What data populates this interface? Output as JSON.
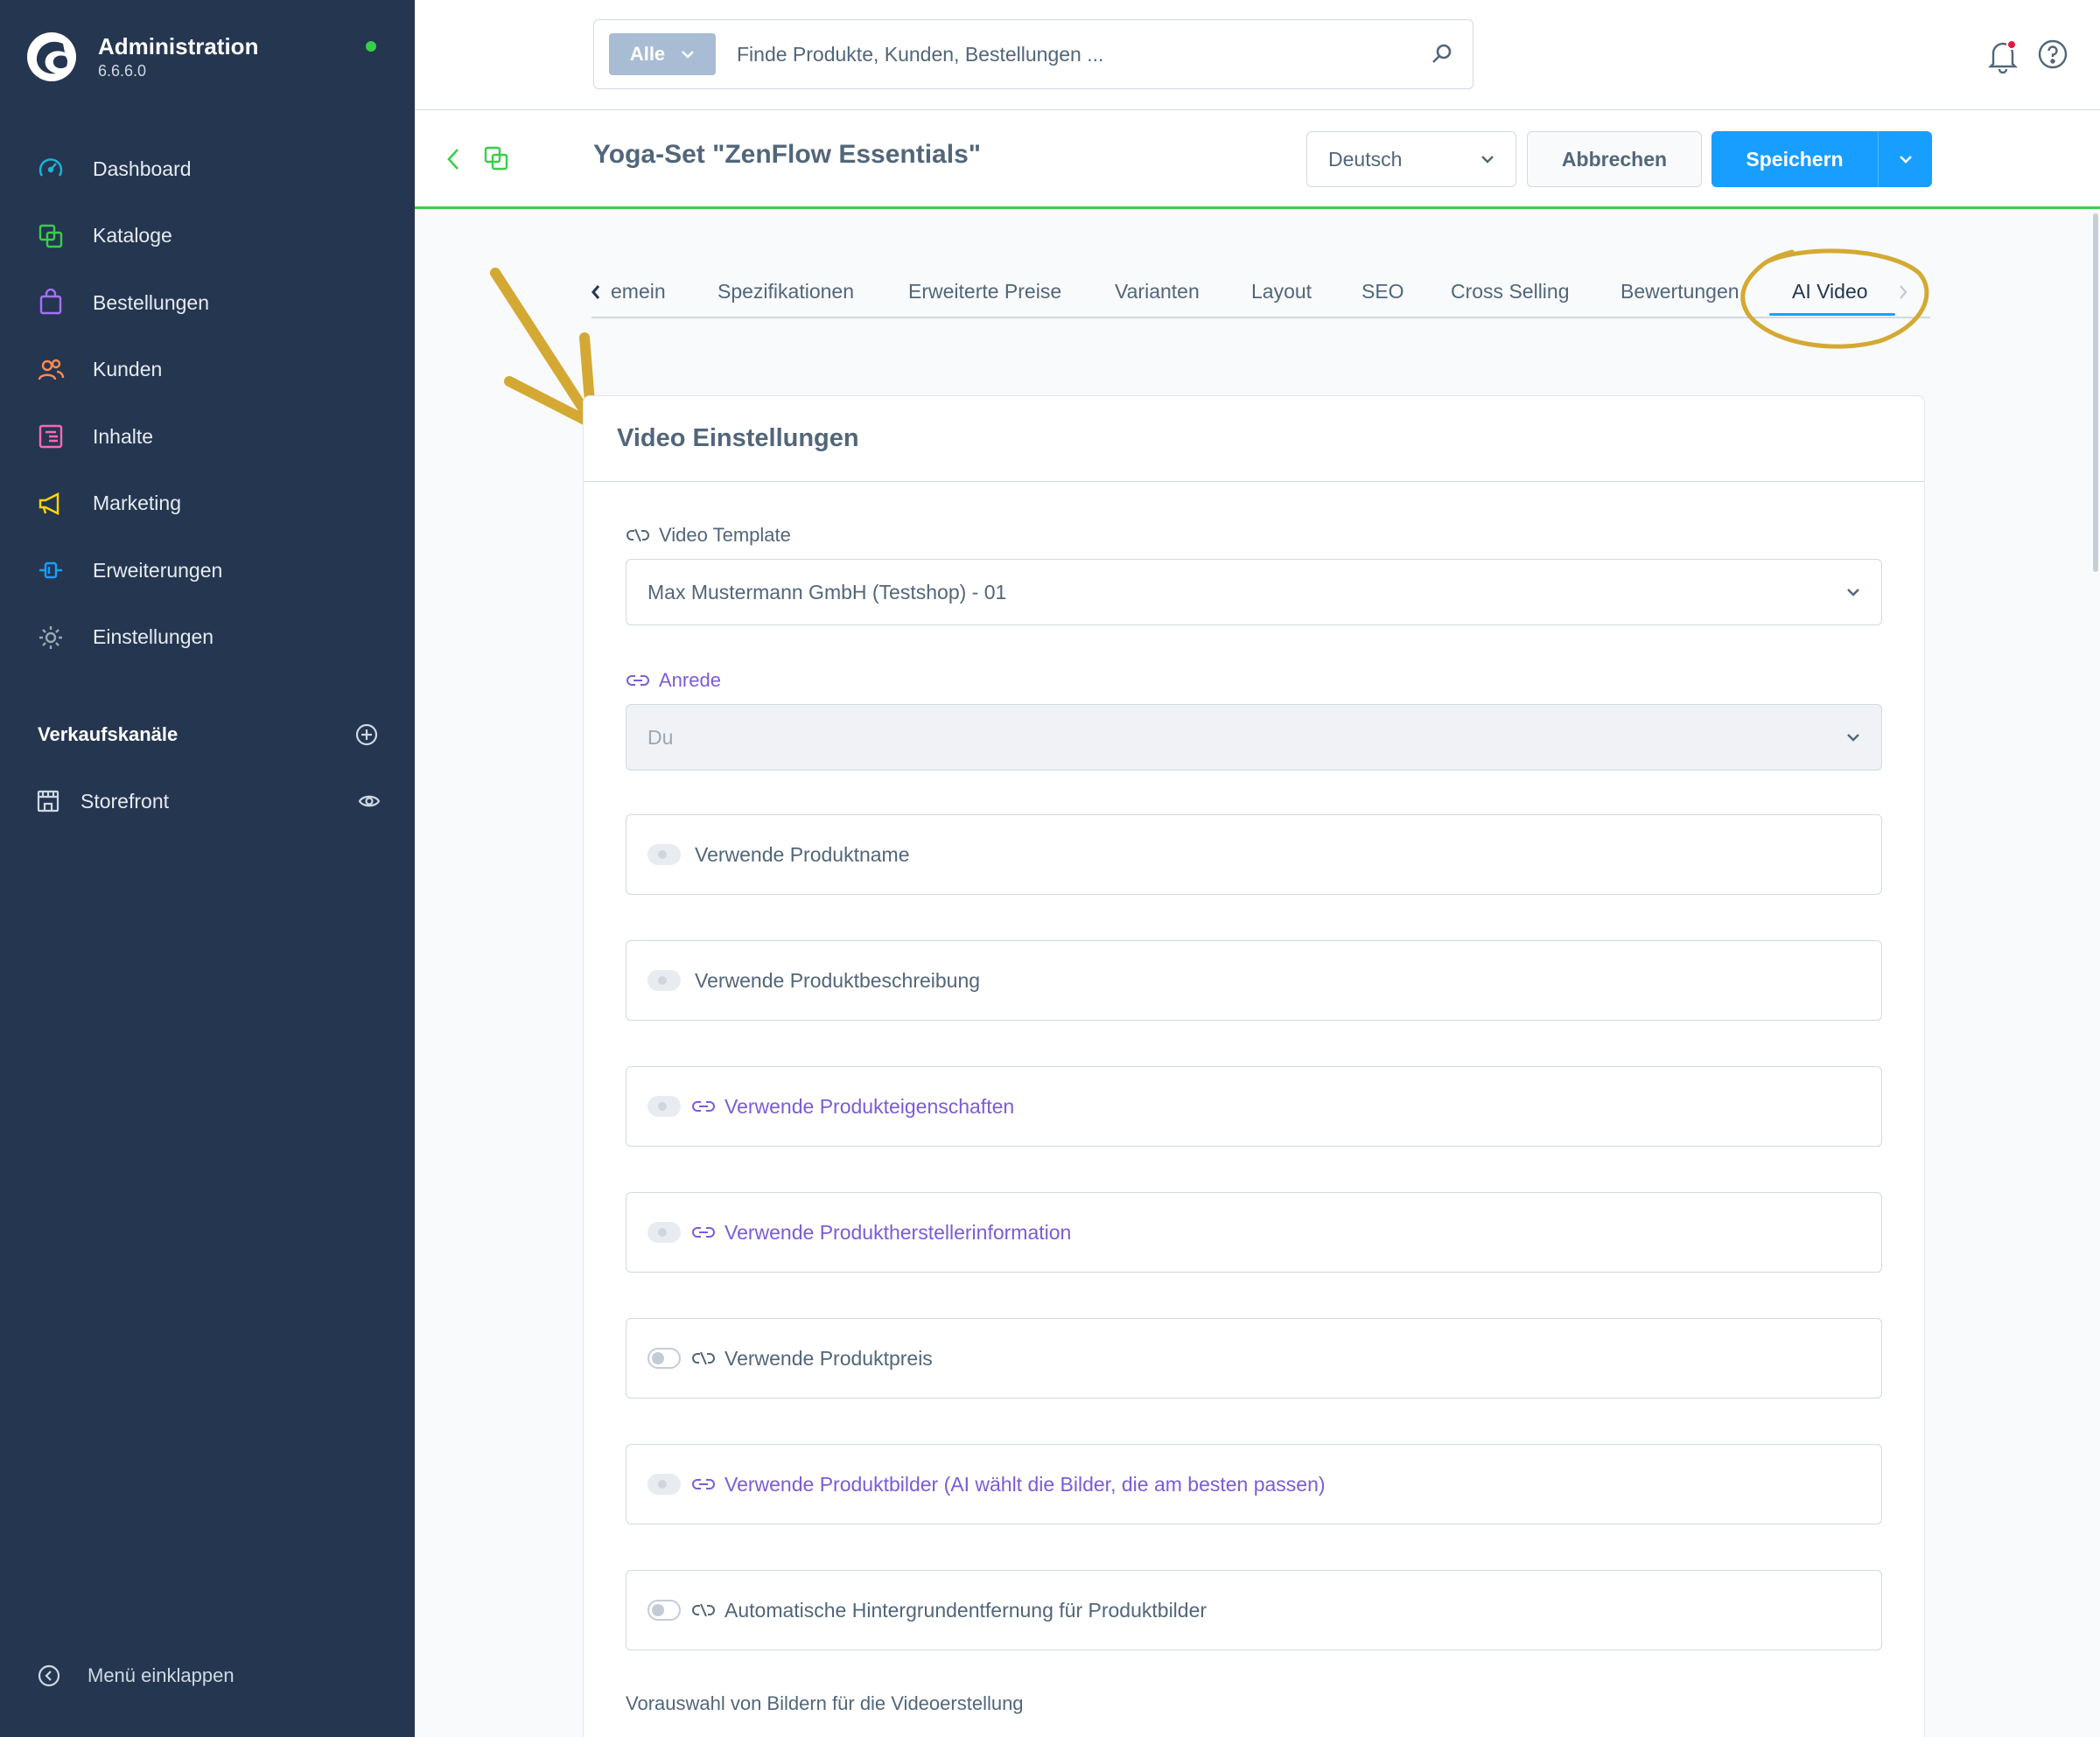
{
  "brand": {
    "title": "Administration",
    "version": "6.6.6.0"
  },
  "sidebar": {
    "items": [
      {
        "label": "Dashboard",
        "icon": "dashboard-icon",
        "color": "#1bb5d6"
      },
      {
        "label": "Kataloge",
        "icon": "catalog-icon",
        "color": "#37d046"
      },
      {
        "label": "Bestellungen",
        "icon": "bag-icon",
        "color": "#a471f8"
      },
      {
        "label": "Kunden",
        "icon": "users-icon",
        "color": "#ff8b52"
      },
      {
        "label": "Inhalte",
        "icon": "content-icon",
        "color": "#ff68b4"
      },
      {
        "label": "Marketing",
        "icon": "megaphone-icon",
        "color": "#ffd700"
      },
      {
        "label": "Erweiterungen",
        "icon": "plug-icon",
        "color": "#189eff"
      },
      {
        "label": "Einstellungen",
        "icon": "gear-icon",
        "color": "#9aa8b5"
      }
    ],
    "channels_title": "Verkaufskanäle",
    "channels": [
      {
        "label": "Storefront"
      }
    ],
    "collapse_label": "Menü einklappen"
  },
  "search": {
    "scope": "Alle",
    "placeholder": "Finde Produkte, Kunden, Bestellungen ..."
  },
  "smartbar": {
    "title": "Yoga-Set \"ZenFlow Essentials\"",
    "language": "Deutsch",
    "cancel_label": "Abbrechen",
    "save_label": "Speichern"
  },
  "tabs": [
    {
      "label": "emein"
    },
    {
      "label": "Spezifikationen"
    },
    {
      "label": "Erweiterte Preise"
    },
    {
      "label": "Varianten"
    },
    {
      "label": "Layout"
    },
    {
      "label": "SEO"
    },
    {
      "label": "Cross Selling"
    },
    {
      "label": "Bewertungen"
    },
    {
      "label": "AI Video",
      "active": true
    }
  ],
  "card": {
    "title": "Video Einstellungen",
    "template_label": "Video Template",
    "template_value": "Max Mustermann GmbH (Testshop) - 01",
    "salutation_label": "Anrede",
    "salutation_value": "Du",
    "toggles": [
      {
        "label": "Verwende Produktname",
        "inherit": false,
        "state": "disabled"
      },
      {
        "label": "Verwende Produktbeschreibung",
        "inherit": false,
        "state": "disabled"
      },
      {
        "label": "Verwende Produkteigenschaften",
        "inherit": true,
        "state": "disabled"
      },
      {
        "label": "Verwende Produktherstellerinformation",
        "inherit": true,
        "state": "disabled"
      },
      {
        "label": "Verwende Produktpreis",
        "inherit": false,
        "state": "off"
      },
      {
        "label": "Verwende Produktbilder (AI wählt die Bilder, die am besten passen)",
        "inherit": true,
        "state": "disabled"
      },
      {
        "label": "Automatische Hintergrundentfernung für Produktbilder",
        "inherit": false,
        "state": "off"
      }
    ],
    "preselect_label": "Vorauswahl von Bildern für die Videoerstellung"
  },
  "colors": {
    "sidebar": "#253650",
    "primary": "#189eff",
    "accent_green": "#37d046",
    "inherit_purple": "#7b5cd6",
    "annotation": "#d4a933"
  }
}
